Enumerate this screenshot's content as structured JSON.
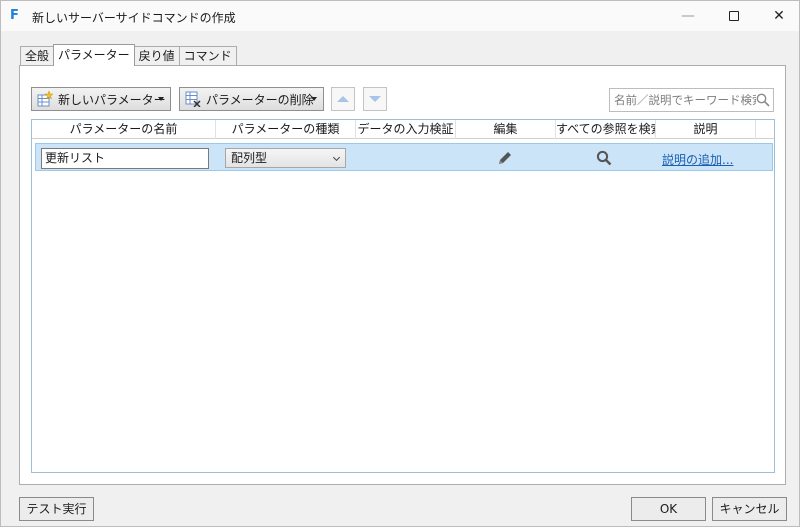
{
  "window": {
    "title": "新しいサーバーサイドコマンドの作成",
    "app_icon_letter": "F",
    "minimize": "—",
    "close": "✕"
  },
  "tabs": [
    {
      "label": "全般",
      "active": false
    },
    {
      "label": "パラメーター",
      "active": true
    },
    {
      "label": "戻り値",
      "active": false
    },
    {
      "label": "コマンド",
      "active": false
    }
  ],
  "toolbar": {
    "new_param_label": "新しいパラメーター",
    "delete_param_label": "パラメーターの削除",
    "search_placeholder": "名前／説明でキーワード検索"
  },
  "grid": {
    "columns": [
      "パラメーターの名前",
      "パラメーターの種類",
      "データの入力検証",
      "編集",
      "すべての参照を検索",
      "説明"
    ],
    "rows": [
      {
        "name": "更新リスト",
        "type": "配列型",
        "validation": "",
        "description_link": "説明の追加..."
      }
    ]
  },
  "footer": {
    "test_run_label": "テスト実行",
    "ok_label": "OK",
    "cancel_label": "キャンセル"
  },
  "colors": {
    "accent": "#1f7fd6",
    "selection_bg": "#cce4f7",
    "link": "#1a5fb4"
  }
}
